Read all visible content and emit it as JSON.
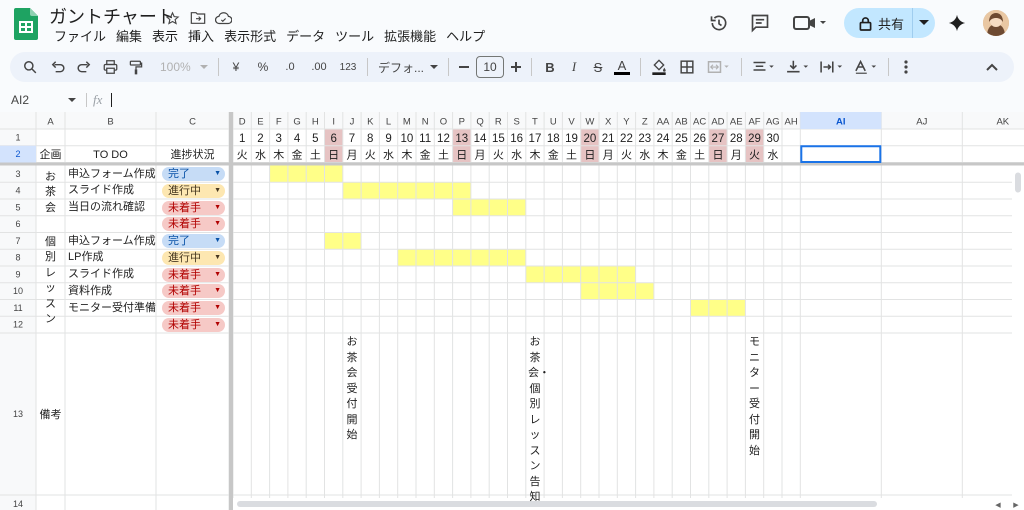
{
  "app": {
    "title": "ガントチャート",
    "menu": [
      "ファイル",
      "編集",
      "表示",
      "挿入",
      "表示形式",
      "データ",
      "ツール",
      "拡張機能",
      "ヘルプ"
    ],
    "share_label": "共有",
    "colors": {
      "accent": "#c2e7ff",
      "selection": "#1a73e8",
      "highlight": "#ffff88",
      "weekend_header": "#e6c3c3",
      "done": "#c6dcf6",
      "in_progress": "#fde7b1",
      "not_started": "#f6c9c6"
    }
  },
  "toolbar": {
    "zoom": "100%",
    "currency": "¥",
    "percent": "%",
    "dec_decrease": ".0",
    "dec_increase": ".00",
    "format_123": "123",
    "font": "デフォ...",
    "font_size": "10",
    "bold": "B",
    "italic": "I",
    "strike": "S",
    "text_color": "A"
  },
  "formula_bar": {
    "name_box": "AI2",
    "fx": "fx",
    "value": ""
  },
  "sheet": {
    "col_letters": [
      "A",
      "B",
      "C",
      "D",
      "E",
      "F",
      "G",
      "H",
      "I",
      "J",
      "K",
      "L",
      "M",
      "N",
      "O",
      "P",
      "Q",
      "R",
      "S",
      "T",
      "U",
      "V",
      "W",
      "X",
      "Y",
      "Z",
      "AA",
      "AB",
      "AC",
      "AD",
      "AE",
      "AF",
      "AG",
      "AH",
      "AI",
      "AJ",
      "AK"
    ],
    "row_numbers": [
      "1",
      "2",
      "3",
      "4",
      "5",
      "6",
      "7",
      "8",
      "9",
      "10",
      "11",
      "12",
      "13",
      "14"
    ],
    "header_row": {
      "a": "企画",
      "b": "TO DO",
      "c": "進捗状況"
    },
    "days": [
      "1",
      "2",
      "3",
      "4",
      "5",
      "6",
      "7",
      "8",
      "9",
      "10",
      "11",
      "12",
      "13",
      "14",
      "15",
      "16",
      "17",
      "18",
      "19",
      "20",
      "21",
      "22",
      "23",
      "24",
      "25",
      "26",
      "27",
      "28",
      "29",
      "30"
    ],
    "weekdays": [
      "火",
      "水",
      "木",
      "金",
      "土",
      "日",
      "月",
      "火",
      "水",
      "木",
      "金",
      "土",
      "日",
      "月",
      "火",
      "水",
      "木",
      "金",
      "土",
      "日",
      "月",
      "火",
      "水",
      "木",
      "金",
      "土",
      "日",
      "月",
      "火",
      "水"
    ],
    "weekend_days": [
      6,
      13,
      20,
      27,
      29
    ],
    "groups": [
      "お茶会",
      "個別レッスン"
    ],
    "remarks_label": "備考",
    "tasks": [
      {
        "name": "申込フォーム作成",
        "status": "完了",
        "kind": "done",
        "start": 3,
        "end": 6
      },
      {
        "name": "スライド作成",
        "status": "進行中",
        "kind": "progress",
        "start": 7,
        "end": 13
      },
      {
        "name": "当日の流れ確認",
        "status": "未着手",
        "kind": "todo",
        "start": 13,
        "end": 16
      },
      {
        "name": "",
        "status": "未着手",
        "kind": "todo",
        "start": 0,
        "end": 0
      },
      {
        "name": "申込フォーム作成",
        "status": "完了",
        "kind": "done",
        "start": 6,
        "end": 7
      },
      {
        "name": "LP作成",
        "status": "進行中",
        "kind": "progress",
        "start": 10,
        "end": 16
      },
      {
        "name": "スライド作成",
        "status": "未着手",
        "kind": "todo",
        "start": 17,
        "end": 22
      },
      {
        "name": "資料作成",
        "status": "未着手",
        "kind": "todo",
        "start": 20,
        "end": 23
      },
      {
        "name": "モニター受付準備",
        "status": "未着手",
        "kind": "todo",
        "start": 26,
        "end": 28
      },
      {
        "name": "",
        "status": "未着手",
        "kind": "todo",
        "start": 0,
        "end": 0
      }
    ],
    "notes": [
      {
        "day": 7,
        "text": "お茶会受付開始"
      },
      {
        "day": 17,
        "text": "お茶会・個別レッスン告知"
      },
      {
        "day": 29,
        "text": "モニター受付開始"
      }
    ],
    "selected_cell": "AI2"
  }
}
